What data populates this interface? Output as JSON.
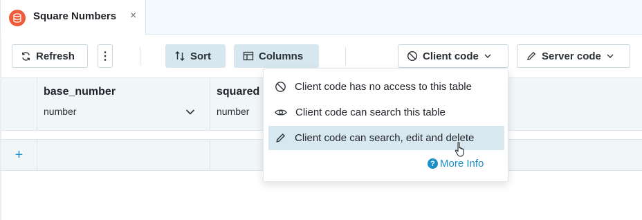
{
  "tab": {
    "title": "Square Numbers",
    "icon": "database-icon",
    "close_glyph": "×",
    "icon_color": "#ef5b3a"
  },
  "toolbar": {
    "refresh_label": "Refresh",
    "sort_label": "Sort",
    "columns_label": "Columns",
    "client_code_label": "Client code",
    "server_code_label": "Server code",
    "more_glyph": "⋮"
  },
  "grid": {
    "columns": [
      {
        "name": "base_number",
        "type": "number"
      },
      {
        "name": "squared",
        "type": "number"
      }
    ],
    "add_row_glyph": "+"
  },
  "client_code_menu": {
    "options": [
      {
        "label": "Client code has no access to this table",
        "icon": "no-access-icon"
      },
      {
        "label": "Client code can search this table",
        "icon": "eye-icon"
      },
      {
        "label": "Client code can search, edit and delete",
        "icon": "pencil-icon"
      }
    ],
    "selected_index": 2,
    "more_info_label": "More Info",
    "more_info_glyph": "?"
  },
  "colors": {
    "accent": "#1a8ec7",
    "selected_bg": "#d8e8f0",
    "button_fill": "#d6e7ef"
  }
}
